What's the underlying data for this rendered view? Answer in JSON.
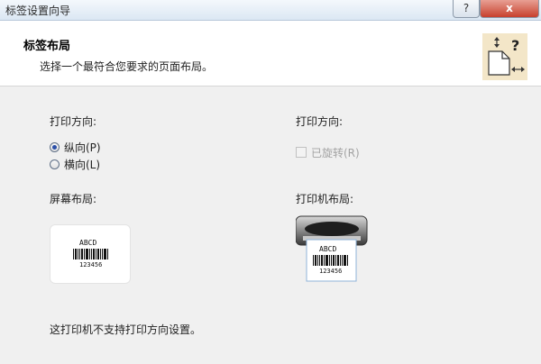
{
  "window": {
    "title": "标签设置向导",
    "help_label": "?",
    "close_label": "x"
  },
  "header": {
    "title": "标签布局",
    "subtitle": "选择一个最符合您要求的页面布局。"
  },
  "left": {
    "orientation_label": "打印方向:",
    "options": [
      {
        "label": "纵向(P)",
        "selected": true
      },
      {
        "label": "横向(L)",
        "selected": false
      }
    ],
    "screen_layout_label": "屏幕布局:",
    "preview_code": "ABCD",
    "preview_digits": "123456"
  },
  "right": {
    "orientation_label": "打印方向:",
    "rotated_label": "已旋转(R)",
    "rotated_checked": false,
    "printer_layout_label": "打印机布局:",
    "preview_code": "ABCD",
    "preview_digits": "123456"
  },
  "footer": {
    "note": "这打印机不支持打印方向设置。"
  },
  "colors": {
    "titlebar": "#dbe7f3",
    "close": "#c7402d",
    "content_bg": "#f0f0f0",
    "radio_dot": "#2b4fa8"
  },
  "icons": [
    "help-icon",
    "close-icon",
    "layout-help-icon",
    "printer-icon",
    "barcode-icon"
  ]
}
